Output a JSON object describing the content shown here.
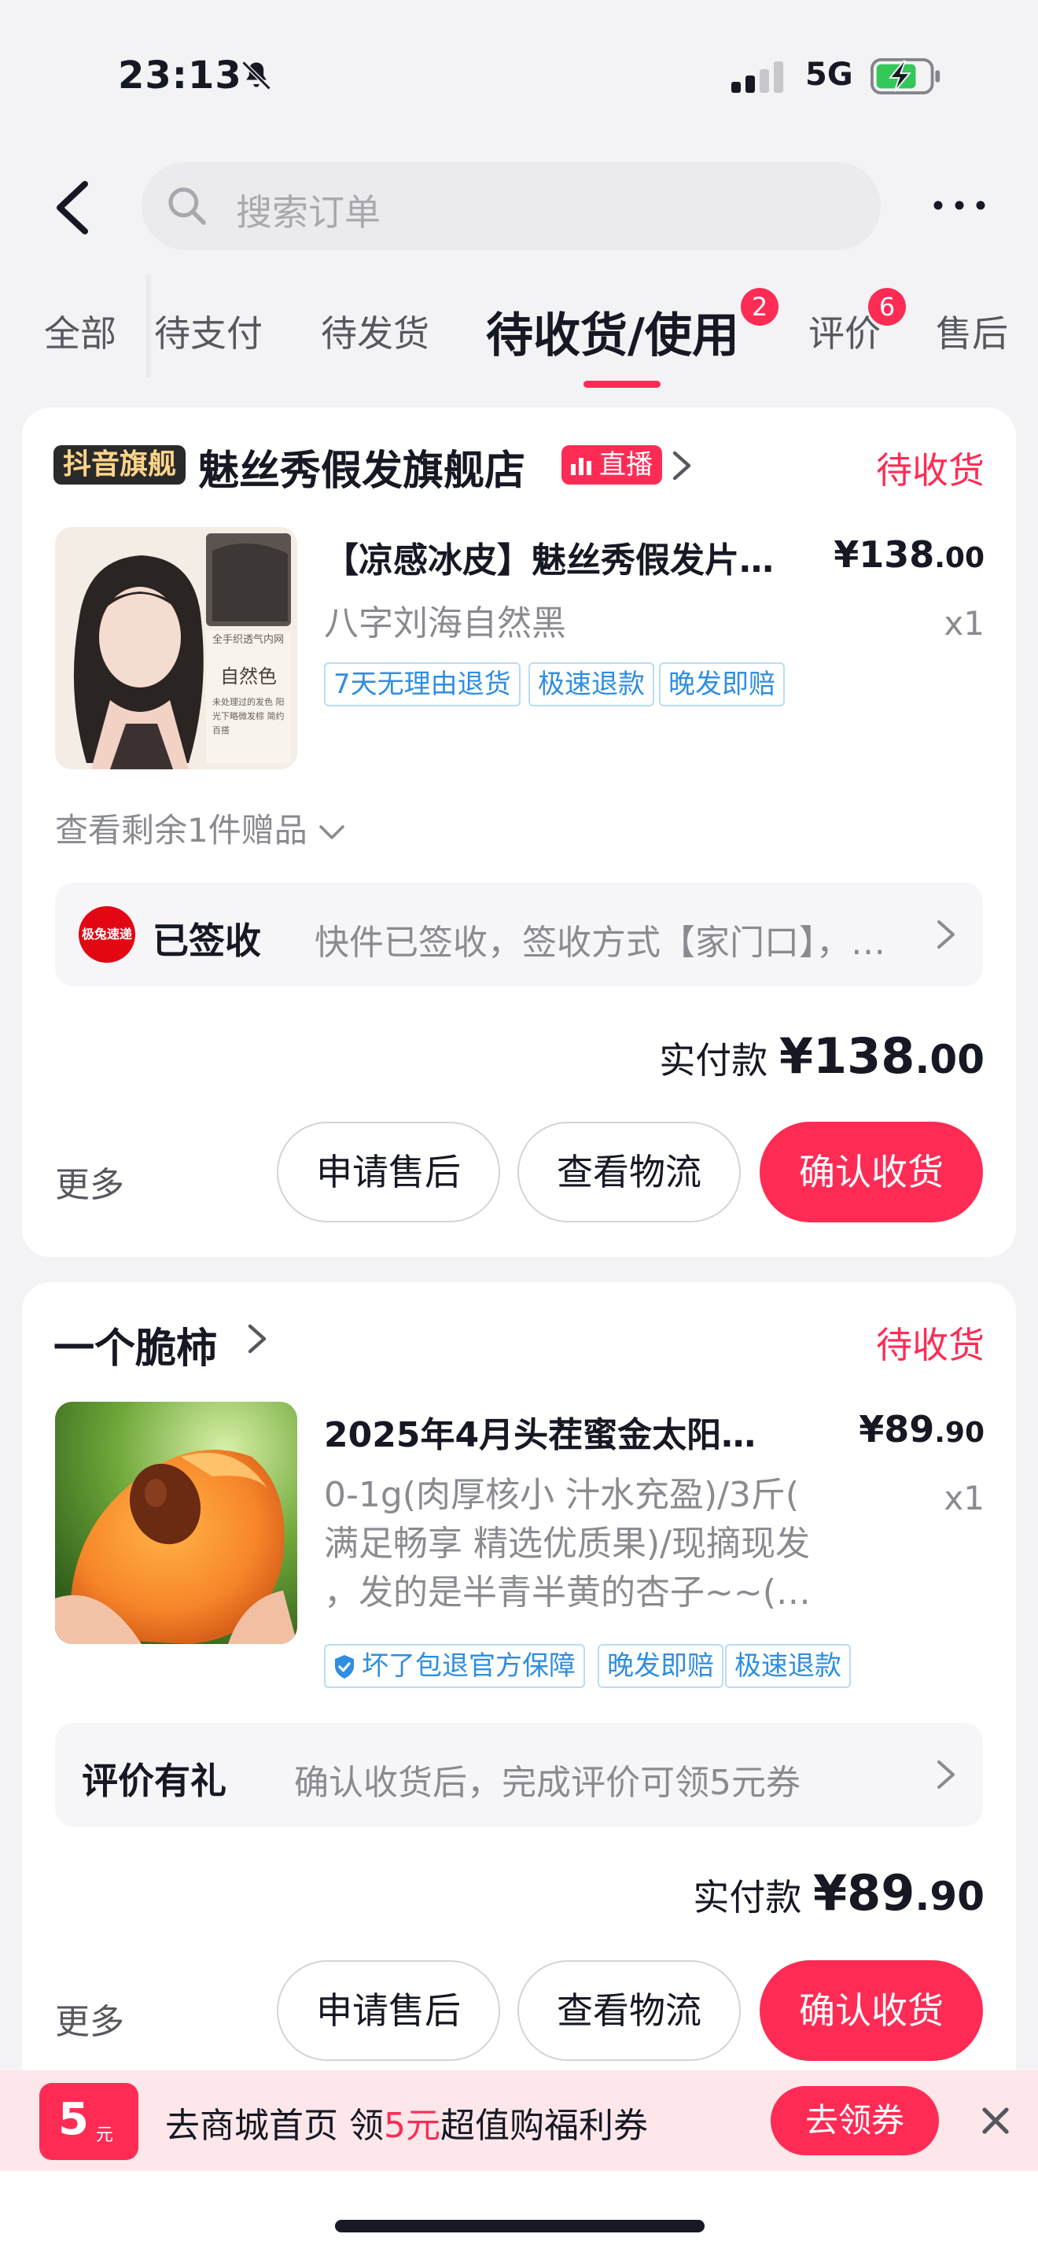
{
  "status_bar": {
    "time": "23:13",
    "network": "5G"
  },
  "search": {
    "placeholder": "搜索订单"
  },
  "tabs": [
    {
      "label": "全部"
    },
    {
      "label": "待支付"
    },
    {
      "label": "待发货"
    },
    {
      "label": "待收货/使用",
      "badge": "2",
      "active": true
    },
    {
      "label": "评价",
      "badge": "6"
    },
    {
      "label": "售后"
    }
  ],
  "orders": [
    {
      "shop_tag": "抖音旗舰",
      "shop_name": "魅丝秀假发旗舰店",
      "live_tag": "直播",
      "status": "待收货",
      "product": {
        "image_text_top": "全手织透气内网",
        "image_text_title": "自然色",
        "image_text_desc": "未处理过的发色 阳光下略微发棕 简约百搭",
        "title": "【凉感冰皮】魅丝秀假发片…",
        "price_int": "¥138",
        "price_dec": ".00",
        "spec": "八字刘海自然黑",
        "qty": "x1",
        "services": [
          "7天无理由退货",
          "极速退款",
          "晚发即赔"
        ]
      },
      "gift_text": "查看剩余1件赠品",
      "logistics": {
        "logo_text": "极兔速递",
        "status": "已签收",
        "desc": "快件已签收，签收方式【家门口】，…"
      },
      "paid_label": "实付款",
      "paid_int": "¥138",
      "paid_dec": ".00",
      "more": "更多",
      "buttons": {
        "after_sale": "申请售后",
        "logistics": "查看物流",
        "confirm": "确认收货"
      }
    },
    {
      "shop_name": "一个脆柿",
      "status": "待收货",
      "product": {
        "title": "2025年4月头茬蜜金太阳…",
        "price_int": "¥89",
        "price_dec": ".90",
        "spec_lines": [
          "0-1g(肉厚核小 汁水充盈)/3斤(",
          "满足畅享 精选优质果)/现摘现发",
          "，发的是半青半黄的杏子~~(…"
        ],
        "qty": "x1",
        "services": [
          "坏了包退官方保障",
          "晚发即赔",
          "极速退款"
        ]
      },
      "review": {
        "label": "评价有礼",
        "desc": "确认收货后，完成评价可领5元券"
      },
      "paid_label": "实付款",
      "paid_int": "¥89",
      "paid_dec": ".90",
      "more": "更多",
      "buttons": {
        "after_sale": "申请售后",
        "logistics": "查看物流",
        "confirm": "确认收货"
      }
    }
  ],
  "banner": {
    "coupon_value": "5",
    "coupon_unit": "元",
    "text_before": "去商城首页 领",
    "text_highlight": "5元",
    "text_after": "超值购福利券",
    "cta": "去领券"
  },
  "colors": {
    "accent": "#fe2c55",
    "service_blue": "#2f8ee0",
    "muted": "#8a8b91"
  }
}
